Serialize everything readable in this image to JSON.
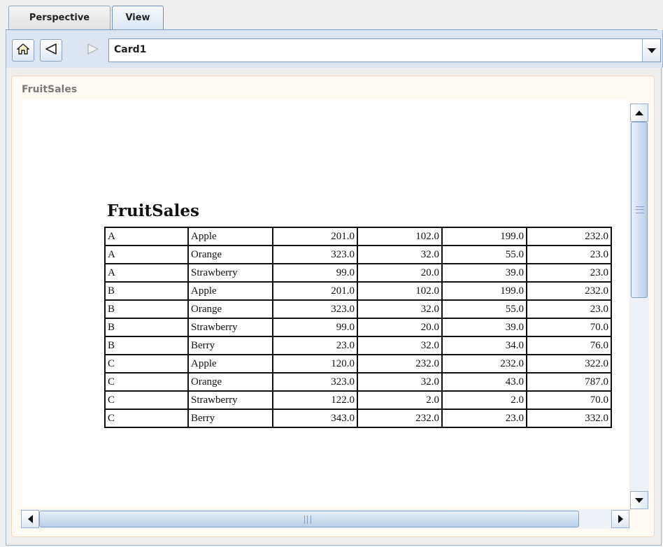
{
  "tabs": [
    {
      "label": "Perspective",
      "active": false
    },
    {
      "label": "View",
      "active": true
    }
  ],
  "toolbar": {
    "home_icon": "home-icon",
    "back_icon": "back-arrow-icon",
    "forward_icon": "forward-arrow-icon",
    "card_selector_value": "Card1",
    "dropdown_icon": "chevron-down-icon"
  },
  "panel": {
    "title": "FruitSales"
  },
  "report": {
    "title": "FruitSales",
    "rows": [
      [
        "A",
        "Apple",
        "201.0",
        "102.0",
        "199.0",
        "232.0"
      ],
      [
        "A",
        "Orange",
        "323.0",
        "32.0",
        "55.0",
        "23.0"
      ],
      [
        "A",
        "Strawberry",
        "99.0",
        "20.0",
        "39.0",
        "23.0"
      ],
      [
        "B",
        "Apple",
        "201.0",
        "102.0",
        "199.0",
        "232.0"
      ],
      [
        "B",
        "Orange",
        "323.0",
        "32.0",
        "55.0",
        "23.0"
      ],
      [
        "B",
        "Strawberry",
        "99.0",
        "20.0",
        "39.0",
        "70.0"
      ],
      [
        "B",
        "Berry",
        "23.0",
        "32.0",
        "34.0",
        "76.0"
      ],
      [
        "C",
        "Apple",
        "120.0",
        "232.0",
        "232.0",
        "322.0"
      ],
      [
        "C",
        "Orange",
        "323.0",
        "32.0",
        "43.0",
        "787.0"
      ],
      [
        "C",
        "Strawberry",
        "122.0",
        "2.0",
        "2.0",
        "70.0"
      ],
      [
        "C",
        "Berry",
        "343.0",
        "232.0",
        "23.0",
        "332.0"
      ]
    ]
  },
  "colors": {
    "accent": "#b9cfe8",
    "panel_border": "#f1d7bd",
    "panel_bg": "#fffaf4"
  }
}
